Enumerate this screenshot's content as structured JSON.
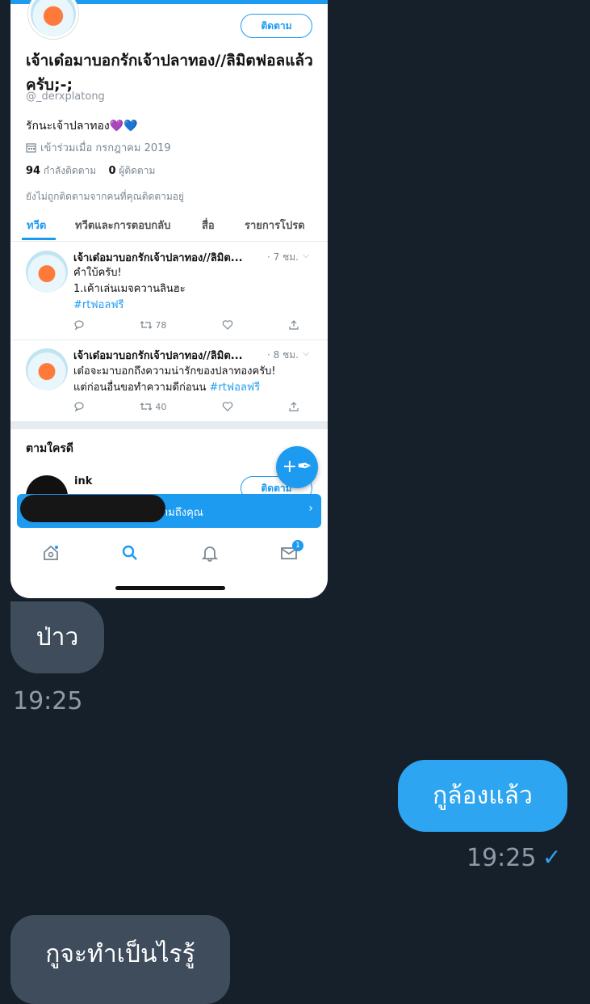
{
  "profile": {
    "name": "เจ้าเด๋อมาบอกรักเจ้าปลาทอง//ลิมิตฟอลแล้วครับ;-;",
    "handle": "@_derxplatong",
    "bio": "รักนะเจ้าปลาทอง💜💙",
    "joined": "เข้าร่วมเมื่อ กรกฎาคม 2019",
    "following_count": "94",
    "following_label": "กำลังติดตาม",
    "followers_count": "0",
    "followers_label": "ผู้ติดตาม",
    "not_followed_note": "ยังไม่ถูกติดตามจากคนที่คุณติดตามอยู่",
    "follow_button": "ติดตาม"
  },
  "tabs": [
    "ทวีต",
    "ทวีตและการตอบกลับ",
    "สื่อ",
    "รายการโปรด"
  ],
  "tweets": [
    {
      "name": "เจ้าเด๋อมาบอกรักเจ้าปลาทอง//ลิมิต...",
      "time": "· 7 ชม.",
      "line1": "คำใบ้ครับ!",
      "line2": "1.เค้าเล่นเมจควานลินฮะ",
      "hashtag": "#rtฟอลฟรี",
      "retweets": "78"
    },
    {
      "name": "เจ้าเด๋อมาบอกรักเจ้าปลาทอง//ลิมิต...",
      "time": "· 8 ชม.",
      "line1": "เด๋อจะมาบอกถึงความน่ารักของปลาทองครับ!",
      "line2": "แต่ก่อนอื่นขอทำความดีก่อนน",
      "hashtag": "#rtฟอลฟรี",
      "retweets": "40"
    }
  ],
  "who_to_follow": {
    "title": "ตามใครดี",
    "name": "ink",
    "follow_button": "ติดตาม"
  },
  "banner_text": "ามถึงคุณ",
  "dm_badge": "1",
  "messages": [
    {
      "text": "ป่าว",
      "direction": "in",
      "time": "19:25"
    },
    {
      "text": "กูล้องแล้ว",
      "direction": "out",
      "time": "19:25",
      "status": "✓"
    },
    {
      "text": "กูจะทำเป็นไรรู้",
      "direction": "in"
    }
  ]
}
